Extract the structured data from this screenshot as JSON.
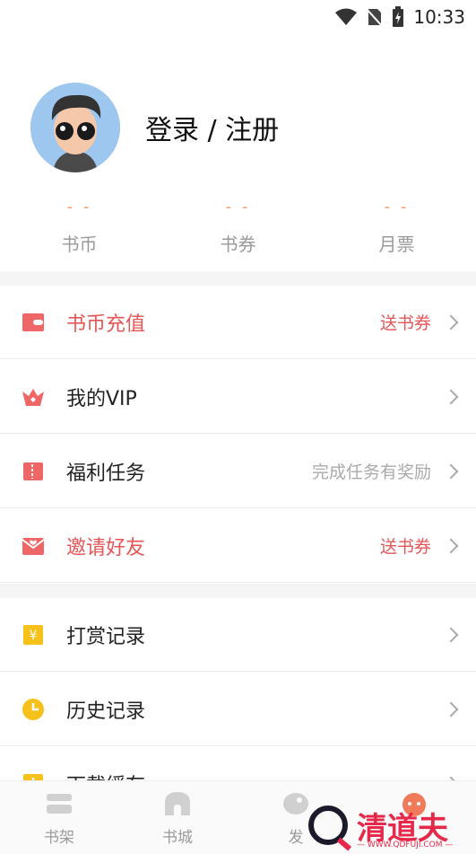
{
  "status": {
    "time": "10:33"
  },
  "profile": {
    "login": "登录 / 注册"
  },
  "stats": [
    {
      "value": "- -",
      "label": "书币"
    },
    {
      "value": "- -",
      "label": "书券"
    },
    {
      "value": "- -",
      "label": "月票"
    }
  ],
  "menu": [
    {
      "label": "书币充值",
      "right": "送书券",
      "icon": "wallet-icon",
      "color": "#e65656"
    },
    {
      "label": "我的VIP",
      "right": "",
      "icon": "crown-icon",
      "color": "#e65656"
    },
    {
      "label": "福利任务",
      "right": "完成任务有奖励",
      "icon": "ticket-icon",
      "color": "#e65656"
    },
    {
      "label": "邀请好友",
      "right": "送书券",
      "icon": "envelope-icon",
      "color": "#e65656"
    },
    {
      "label": "打赏记录",
      "right": "",
      "icon": "yuan-icon",
      "color": "#f5c11a"
    },
    {
      "label": "历史记录",
      "right": "",
      "icon": "clock-icon",
      "color": "#f5c11a"
    },
    {
      "label": "下载缓存",
      "right": "",
      "icon": "download-icon",
      "color": "#f5c11a"
    }
  ],
  "tabs": [
    {
      "label": "书架",
      "icon": "bookshelf-icon"
    },
    {
      "label": "书城",
      "icon": "bookstore-icon"
    },
    {
      "label": "发",
      "icon": "discover-icon"
    },
    {
      "label": "",
      "icon": "profile-icon"
    }
  ],
  "watermark": {
    "brand": "清道夫",
    "site": "— WWW.QDFUJI.COM —"
  }
}
